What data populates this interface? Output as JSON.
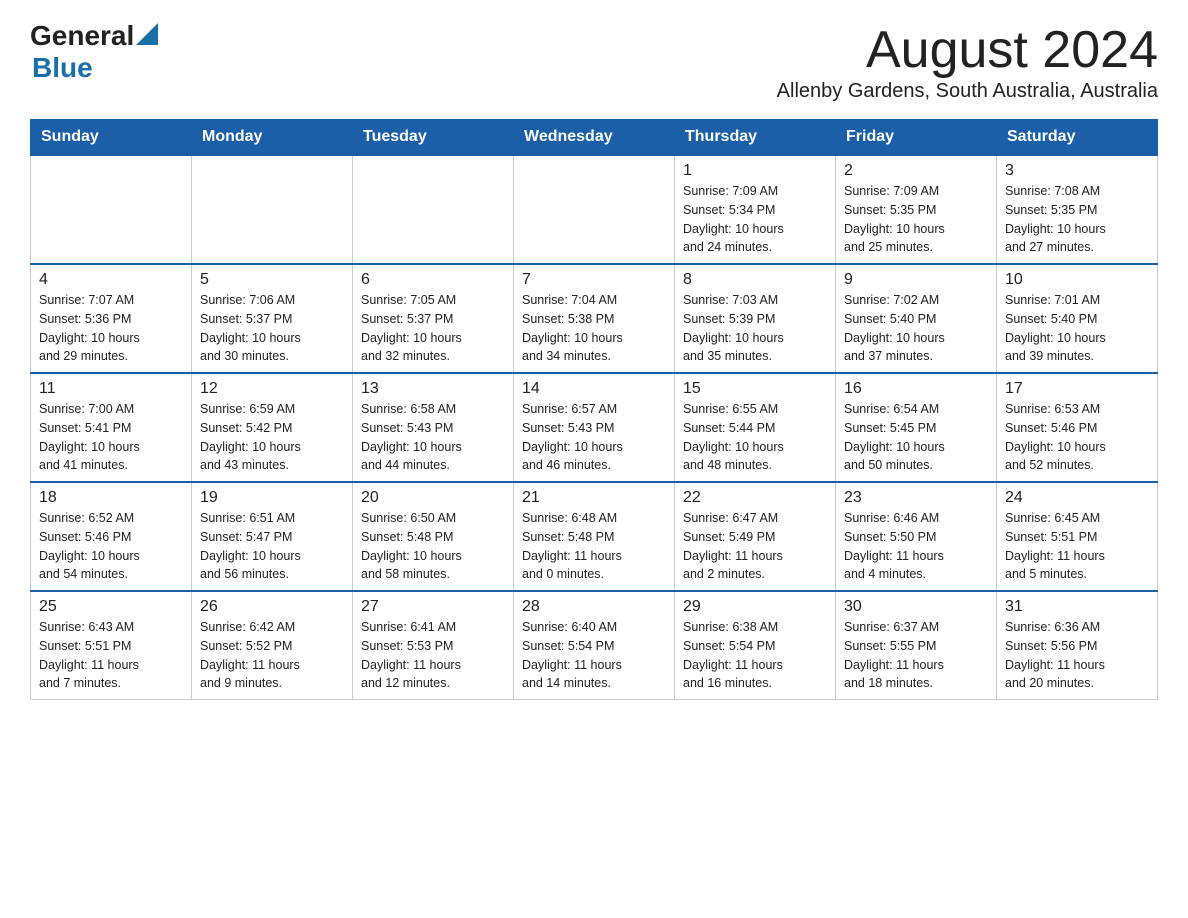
{
  "header": {
    "logo_general": "General",
    "logo_blue": "Blue",
    "month_title": "August 2024",
    "subtitle": "Allenby Gardens, South Australia, Australia"
  },
  "days_of_week": [
    "Sunday",
    "Monday",
    "Tuesday",
    "Wednesday",
    "Thursday",
    "Friday",
    "Saturday"
  ],
  "weeks": [
    [
      {
        "day": "",
        "info": ""
      },
      {
        "day": "",
        "info": ""
      },
      {
        "day": "",
        "info": ""
      },
      {
        "day": "",
        "info": ""
      },
      {
        "day": "1",
        "info": "Sunrise: 7:09 AM\nSunset: 5:34 PM\nDaylight: 10 hours\nand 24 minutes."
      },
      {
        "day": "2",
        "info": "Sunrise: 7:09 AM\nSunset: 5:35 PM\nDaylight: 10 hours\nand 25 minutes."
      },
      {
        "day": "3",
        "info": "Sunrise: 7:08 AM\nSunset: 5:35 PM\nDaylight: 10 hours\nand 27 minutes."
      }
    ],
    [
      {
        "day": "4",
        "info": "Sunrise: 7:07 AM\nSunset: 5:36 PM\nDaylight: 10 hours\nand 29 minutes."
      },
      {
        "day": "5",
        "info": "Sunrise: 7:06 AM\nSunset: 5:37 PM\nDaylight: 10 hours\nand 30 minutes."
      },
      {
        "day": "6",
        "info": "Sunrise: 7:05 AM\nSunset: 5:37 PM\nDaylight: 10 hours\nand 32 minutes."
      },
      {
        "day": "7",
        "info": "Sunrise: 7:04 AM\nSunset: 5:38 PM\nDaylight: 10 hours\nand 34 minutes."
      },
      {
        "day": "8",
        "info": "Sunrise: 7:03 AM\nSunset: 5:39 PM\nDaylight: 10 hours\nand 35 minutes."
      },
      {
        "day": "9",
        "info": "Sunrise: 7:02 AM\nSunset: 5:40 PM\nDaylight: 10 hours\nand 37 minutes."
      },
      {
        "day": "10",
        "info": "Sunrise: 7:01 AM\nSunset: 5:40 PM\nDaylight: 10 hours\nand 39 minutes."
      }
    ],
    [
      {
        "day": "11",
        "info": "Sunrise: 7:00 AM\nSunset: 5:41 PM\nDaylight: 10 hours\nand 41 minutes."
      },
      {
        "day": "12",
        "info": "Sunrise: 6:59 AM\nSunset: 5:42 PM\nDaylight: 10 hours\nand 43 minutes."
      },
      {
        "day": "13",
        "info": "Sunrise: 6:58 AM\nSunset: 5:43 PM\nDaylight: 10 hours\nand 44 minutes."
      },
      {
        "day": "14",
        "info": "Sunrise: 6:57 AM\nSunset: 5:43 PM\nDaylight: 10 hours\nand 46 minutes."
      },
      {
        "day": "15",
        "info": "Sunrise: 6:55 AM\nSunset: 5:44 PM\nDaylight: 10 hours\nand 48 minutes."
      },
      {
        "day": "16",
        "info": "Sunrise: 6:54 AM\nSunset: 5:45 PM\nDaylight: 10 hours\nand 50 minutes."
      },
      {
        "day": "17",
        "info": "Sunrise: 6:53 AM\nSunset: 5:46 PM\nDaylight: 10 hours\nand 52 minutes."
      }
    ],
    [
      {
        "day": "18",
        "info": "Sunrise: 6:52 AM\nSunset: 5:46 PM\nDaylight: 10 hours\nand 54 minutes."
      },
      {
        "day": "19",
        "info": "Sunrise: 6:51 AM\nSunset: 5:47 PM\nDaylight: 10 hours\nand 56 minutes."
      },
      {
        "day": "20",
        "info": "Sunrise: 6:50 AM\nSunset: 5:48 PM\nDaylight: 10 hours\nand 58 minutes."
      },
      {
        "day": "21",
        "info": "Sunrise: 6:48 AM\nSunset: 5:48 PM\nDaylight: 11 hours\nand 0 minutes."
      },
      {
        "day": "22",
        "info": "Sunrise: 6:47 AM\nSunset: 5:49 PM\nDaylight: 11 hours\nand 2 minutes."
      },
      {
        "day": "23",
        "info": "Sunrise: 6:46 AM\nSunset: 5:50 PM\nDaylight: 11 hours\nand 4 minutes."
      },
      {
        "day": "24",
        "info": "Sunrise: 6:45 AM\nSunset: 5:51 PM\nDaylight: 11 hours\nand 5 minutes."
      }
    ],
    [
      {
        "day": "25",
        "info": "Sunrise: 6:43 AM\nSunset: 5:51 PM\nDaylight: 11 hours\nand 7 minutes."
      },
      {
        "day": "26",
        "info": "Sunrise: 6:42 AM\nSunset: 5:52 PM\nDaylight: 11 hours\nand 9 minutes."
      },
      {
        "day": "27",
        "info": "Sunrise: 6:41 AM\nSunset: 5:53 PM\nDaylight: 11 hours\nand 12 minutes."
      },
      {
        "day": "28",
        "info": "Sunrise: 6:40 AM\nSunset: 5:54 PM\nDaylight: 11 hours\nand 14 minutes."
      },
      {
        "day": "29",
        "info": "Sunrise: 6:38 AM\nSunset: 5:54 PM\nDaylight: 11 hours\nand 16 minutes."
      },
      {
        "day": "30",
        "info": "Sunrise: 6:37 AM\nSunset: 5:55 PM\nDaylight: 11 hours\nand 18 minutes."
      },
      {
        "day": "31",
        "info": "Sunrise: 6:36 AM\nSunset: 5:56 PM\nDaylight: 11 hours\nand 20 minutes."
      }
    ]
  ]
}
